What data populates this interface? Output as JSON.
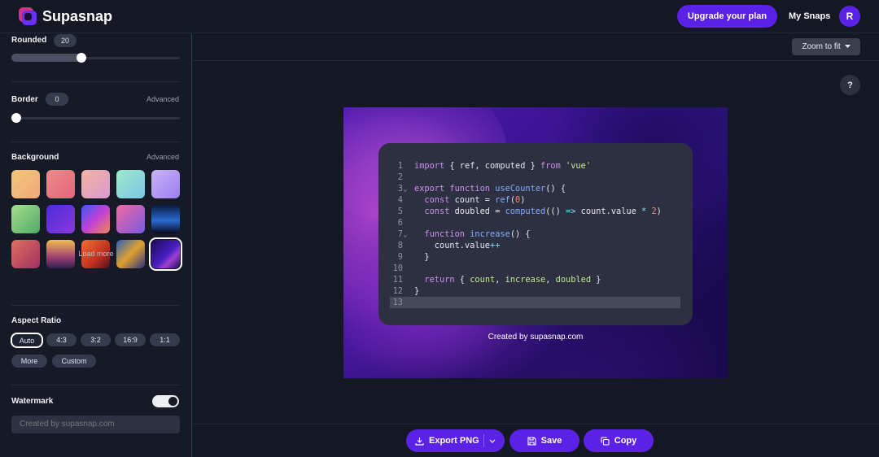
{
  "app": {
    "name": "Supasnap"
  },
  "header": {
    "upgrade_label": "Upgrade your plan",
    "my_snaps_label": "My Snaps",
    "avatar_initial": "R"
  },
  "sidebar": {
    "rounded": {
      "label": "Rounded",
      "value": "20",
      "level": 0.41
    },
    "border": {
      "label": "Border",
      "value": "0",
      "advanced_label": "Advanced",
      "level": 0.0
    },
    "background": {
      "label": "Background",
      "advanced_label": "Advanced",
      "load_more_label": "Load more",
      "selected_index": 14
    },
    "aspect_ratio": {
      "label": "Aspect Ratio",
      "options": [
        "Auto",
        "4:3",
        "3:2",
        "16:9",
        "1:1",
        "More",
        "Custom"
      ],
      "selected": "Auto"
    },
    "watermark": {
      "label": "Watermark",
      "enabled": true,
      "placeholder": "Created by supasnap.com"
    }
  },
  "main": {
    "zoom_label": "Zoom to fit",
    "help_label": "?",
    "credit": "Created by supasnap.com",
    "code": {
      "lines": [
        "import { ref, computed } from 'vue'",
        "",
        "export function useCounter() {",
        "  const count = ref(0)",
        "  const doubled = computed(() => count.value * 2)",
        "",
        "  function increase() {",
        "    count.value++",
        "  }",
        "",
        "  return { count, increase, doubled }",
        "}",
        ""
      ],
      "line_numbers": [
        "1",
        "2",
        "3",
        "4",
        "5",
        "6",
        "7",
        "8",
        "9",
        "10",
        "11",
        "12",
        "13"
      ],
      "active_line": 13
    }
  },
  "actions": {
    "export_label": "Export PNG",
    "save_label": "Save",
    "copy_label": "Copy"
  },
  "colors": {
    "accent": "#5b21e6",
    "sidebar_border": "#6b2340",
    "code_bg": "#2d3040"
  },
  "icons": [
    "logo-icon",
    "chevron-down-icon",
    "download-icon",
    "save-icon",
    "copy-icon",
    "fold-icon"
  ]
}
